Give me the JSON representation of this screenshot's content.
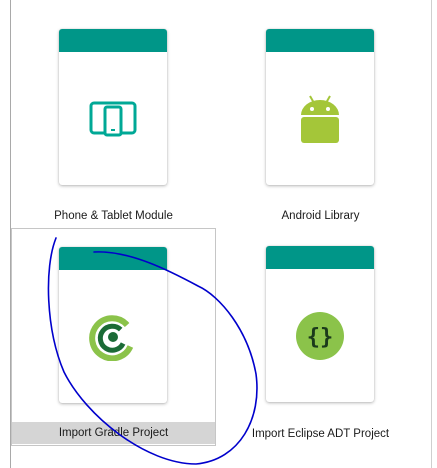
{
  "modules": [
    {
      "label": "Phone & Tablet Module",
      "icon": "phone-tablet-icon",
      "selected": false
    },
    {
      "label": "Android Library",
      "icon": "android-icon",
      "selected": false
    },
    {
      "label": "Import Gradle Project",
      "icon": "gradle-icon",
      "selected": true
    },
    {
      "label": "Import Eclipse ADT Project",
      "icon": "eclipse-adt-icon",
      "selected": false
    }
  ],
  "colors": {
    "header_teal": "#009688",
    "android_green": "#a4c639",
    "gradle_dark_green": "#1b6b36",
    "gradle_light_green": "#8bc34a",
    "annotation_blue": "#0000cc",
    "selection_gray": "#d5d5d5"
  }
}
